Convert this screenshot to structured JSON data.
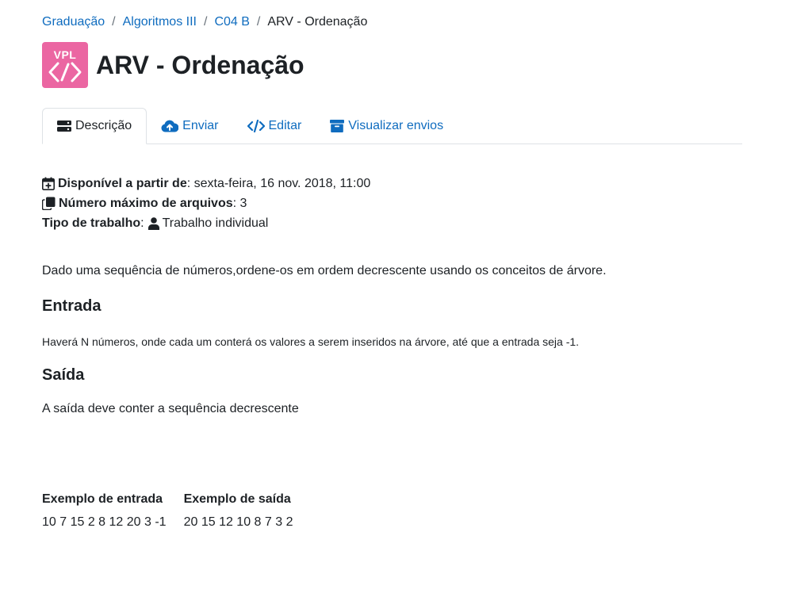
{
  "breadcrumb": {
    "items": [
      "Graduação",
      "Algoritmos III",
      "C04 B"
    ],
    "current": "ARV - Ordenação",
    "separator": "/"
  },
  "header": {
    "logo_text": "VPL",
    "title": "ARV - Ordenação"
  },
  "tabs": [
    {
      "label": "Descrição",
      "icon": "server-icon",
      "active": true
    },
    {
      "label": "Enviar",
      "icon": "cloud-upload-icon",
      "active": false
    },
    {
      "label": "Editar",
      "icon": "code-icon",
      "active": false
    },
    {
      "label": "Visualizar envios",
      "icon": "archive-icon",
      "active": false
    }
  ],
  "info": {
    "available_label": "Disponível a partir de",
    "available_value": ": sexta-feira, 16 nov. 2018, 11:00",
    "max_files_label": "Número máximo de arquivos",
    "max_files_value": ": 3",
    "work_type_label": "Tipo de trabalho",
    "work_type_sep": ":",
    "work_type_value": "Trabalho individual"
  },
  "description": {
    "intro": "Dado uma sequência de números,ordene-os em ordem decrescente usando os conceitos de árvore.",
    "input_heading": "Entrada",
    "input_text": "Haverá N números, onde cada um conterá os valores a serem inseridos na árvore, até que a entrada seja -1.",
    "output_heading": "Saída",
    "output_text": "A saída deve conter a sequência decrescente"
  },
  "examples": {
    "headers": [
      "Exemplo de entrada",
      "Exemplo de saída"
    ],
    "rows": [
      [
        "10 7 15 2 8 12 20 3 -1",
        "20 15 12 10 8 7 3 2"
      ]
    ]
  },
  "colors": {
    "link": "#0f6cbf",
    "logo": "#eb66a2",
    "text": "#1d2125",
    "border": "#dee2e6"
  }
}
